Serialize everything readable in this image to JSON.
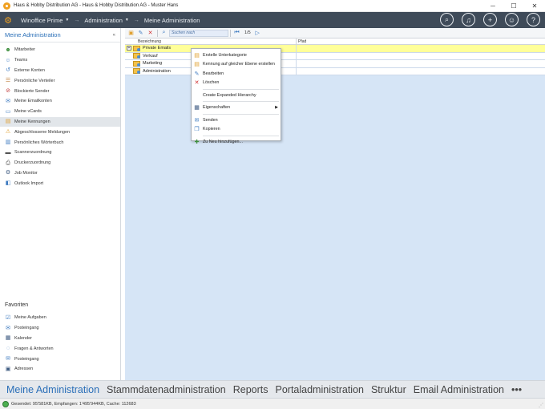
{
  "window": {
    "title": "Haus & Hobby Distribution AG - Haus & Hobby Distribution AG - Muster Hans",
    "icons": {
      "app": "gear-app-icon",
      "minimize": "minimize-icon",
      "maximize": "maximize-icon",
      "close": "close-icon"
    }
  },
  "header": {
    "crumbs": [
      {
        "label": "Winoffice Prime",
        "has_dropdown": true
      },
      {
        "label": "Administration",
        "has_dropdown": true
      },
      {
        "label": "Meine Administration",
        "has_dropdown": false
      }
    ],
    "icons": [
      "search-icon",
      "bell-icon",
      "add-icon",
      "user-icon",
      "help-icon"
    ],
    "colors": {
      "background": "#3f4b59",
      "accent": "#f0a020"
    }
  },
  "sidebar": {
    "title": "Meine Administration",
    "pin": "«",
    "items": [
      {
        "label": "Mitarbeiter",
        "icon": "person-icon",
        "color": "#3d8f3d",
        "active": false
      },
      {
        "label": "Teams",
        "icon": "team-icon",
        "color": "#3d7ac0",
        "active": false
      },
      {
        "label": "Externe Konten",
        "icon": "external-accounts-icon",
        "color": "#3d7ac0",
        "active": false
      },
      {
        "label": "Persönliche Verteiler",
        "icon": "distribution-list-icon",
        "color": "#c0803d",
        "active": false
      },
      {
        "label": "Blockierte Sender",
        "icon": "blocked-sender-icon",
        "color": "#c03d3d",
        "active": false
      },
      {
        "label": "Meine Emailkonten",
        "icon": "email-account-icon",
        "color": "#3d7ac0",
        "active": false
      },
      {
        "label": "Meine vCards",
        "icon": "vcard-icon",
        "color": "#3d7ac0",
        "active": false
      },
      {
        "label": "Meine Kennungen",
        "icon": "folder-tag-icon",
        "color": "#e0a030",
        "active": true
      },
      {
        "label": "Abgeschlossene Meldungen",
        "icon": "warning-icon",
        "color": "#e0a030",
        "active": false
      },
      {
        "label": "Persönliches Wörterbuch",
        "icon": "dictionary-icon",
        "color": "#3d7ac0",
        "active": false
      },
      {
        "label": "Scannerzuordnung",
        "icon": "scanner-icon",
        "color": "#555555",
        "active": false
      },
      {
        "label": "Druckerzuordnung",
        "icon": "printer-icon",
        "color": "#555555",
        "active": false
      },
      {
        "label": "Job Monitor",
        "icon": "job-monitor-icon",
        "color": "#3d5a80",
        "active": false
      },
      {
        "label": "Outlook Import",
        "icon": "outlook-icon",
        "color": "#3d7ac0",
        "active": false
      }
    ],
    "favorites_title": "Favoriten",
    "favorites": [
      {
        "label": "Meine Aufgaben",
        "icon": "tasks-icon",
        "color": "#3d7ac0"
      },
      {
        "label": "Posteingang",
        "icon": "inbox-icon",
        "color": "#3d7ac0"
      },
      {
        "label": "Kalender",
        "icon": "calendar-icon",
        "color": "#3d5a80"
      },
      {
        "label": "Fragen & Antworten",
        "icon": "chat-icon",
        "color": "#3d7ac0"
      },
      {
        "label": "Posteingang",
        "icon": "inbox-icon",
        "color": "#3d7ac0"
      },
      {
        "label": "Adressen",
        "icon": "address-book-icon",
        "color": "#3d5a80"
      }
    ]
  },
  "toolbar": {
    "search_placeholder": "Suchen nach",
    "pager": "1/5",
    "icons": [
      "add-folder-icon",
      "edit-icon",
      "delete-icon",
      "search-icon",
      "first-page-icon",
      "next-page-icon"
    ]
  },
  "grid": {
    "columns": [
      "Bezeichnung",
      "Pfad"
    ],
    "rows": [
      {
        "name": "Private Emails",
        "path": "",
        "expandable": true,
        "selected": true
      },
      {
        "name": "Verkauf",
        "path": "",
        "expandable": false,
        "selected": false
      },
      {
        "name": "Marketing",
        "path": "",
        "expandable": false,
        "selected": false
      },
      {
        "name": "Administration",
        "path": "",
        "expandable": false,
        "selected": false
      }
    ],
    "expander_symbol": "+"
  },
  "context_menu": {
    "items": [
      {
        "label": "Erstelle Unterkategorie",
        "icon": "new-subcategory-icon",
        "glyph": "▤",
        "color": "#e0a030"
      },
      {
        "label": "Kennung auf gleicher Ebene erstellen",
        "icon": "new-sibling-icon",
        "glyph": "▤",
        "color": "#e0a030"
      },
      {
        "label": "Bearbeiten",
        "icon": "edit-icon",
        "glyph": "✎",
        "color": "#3d7ac0"
      },
      {
        "label": "Löschen",
        "icon": "delete-icon",
        "glyph": "✕",
        "color": "#d03030",
        "sep_after": true
      },
      {
        "label": "Create Expanded Hierarchy",
        "icon": "",
        "glyph": "",
        "color": "#333333",
        "sep_after": true
      },
      {
        "label": "Eigenschaften",
        "icon": "properties-icon",
        "glyph": "▦",
        "color": "#3d5a80",
        "submenu": true,
        "sep_after": true
      },
      {
        "label": "Senden",
        "icon": "send-icon",
        "glyph": "✉",
        "color": "#3d7ac0"
      },
      {
        "label": "Kopieren",
        "icon": "copy-icon",
        "glyph": "❐",
        "color": "#3d7ac0",
        "sep_after": true
      },
      {
        "label": "Zu Neu hinzufügen...",
        "icon": "add-to-new-icon",
        "glyph": "✚",
        "color": "#3d8f3d"
      }
    ],
    "submenu_arrow": "▶"
  },
  "module_tabs": {
    "tabs": [
      {
        "label": "Meine Administration",
        "active": true
      },
      {
        "label": "Stammdatenadministration",
        "active": false
      },
      {
        "label": "Reports",
        "active": false
      },
      {
        "label": "Portaladministration",
        "active": false
      },
      {
        "label": "Struktur",
        "active": false
      },
      {
        "label": "Email Administration",
        "active": false
      }
    ],
    "more": "•••"
  },
  "statusbar": {
    "text": "Gesendet: 95'581KB, Empfangen: 1'495'944KB, Cache: 112683"
  }
}
